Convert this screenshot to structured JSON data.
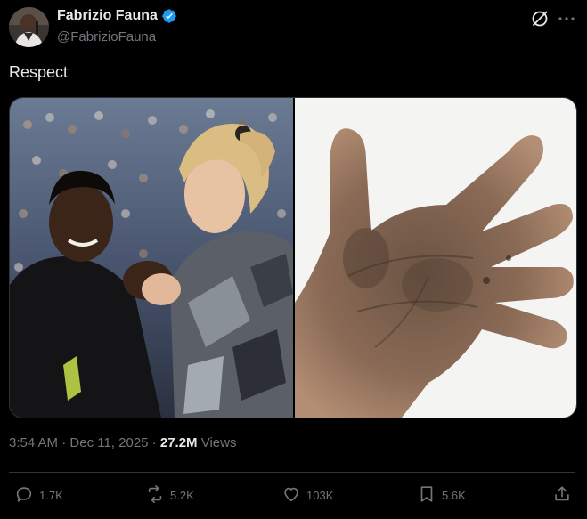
{
  "author": {
    "display_name": "Fabrizio Fauna",
    "handle": "@FabrizioFauna",
    "avatar_icon": "avatar-photo",
    "verified_icon": "verified-badge-icon"
  },
  "tweet": {
    "text": "Respect"
  },
  "media": {
    "left_image": "two-players-handshake-photo",
    "right_image": "dirty-hand-photo"
  },
  "meta": {
    "time": "3:54 AM",
    "separator1": " · ",
    "date": "Dec 11, 2025",
    "separator2": " · ",
    "views_count": "27.2M",
    "views_label": " Views"
  },
  "actions": {
    "replies": "1.7K",
    "retweets": "5.2K",
    "likes": "103K",
    "bookmarks": "5.6K"
  },
  "colors": {
    "background": "#000000",
    "text_primary": "#e7e9ea",
    "text_secondary": "#71767b",
    "border": "#2f3336",
    "verified_blue": "#1d9bf0"
  }
}
